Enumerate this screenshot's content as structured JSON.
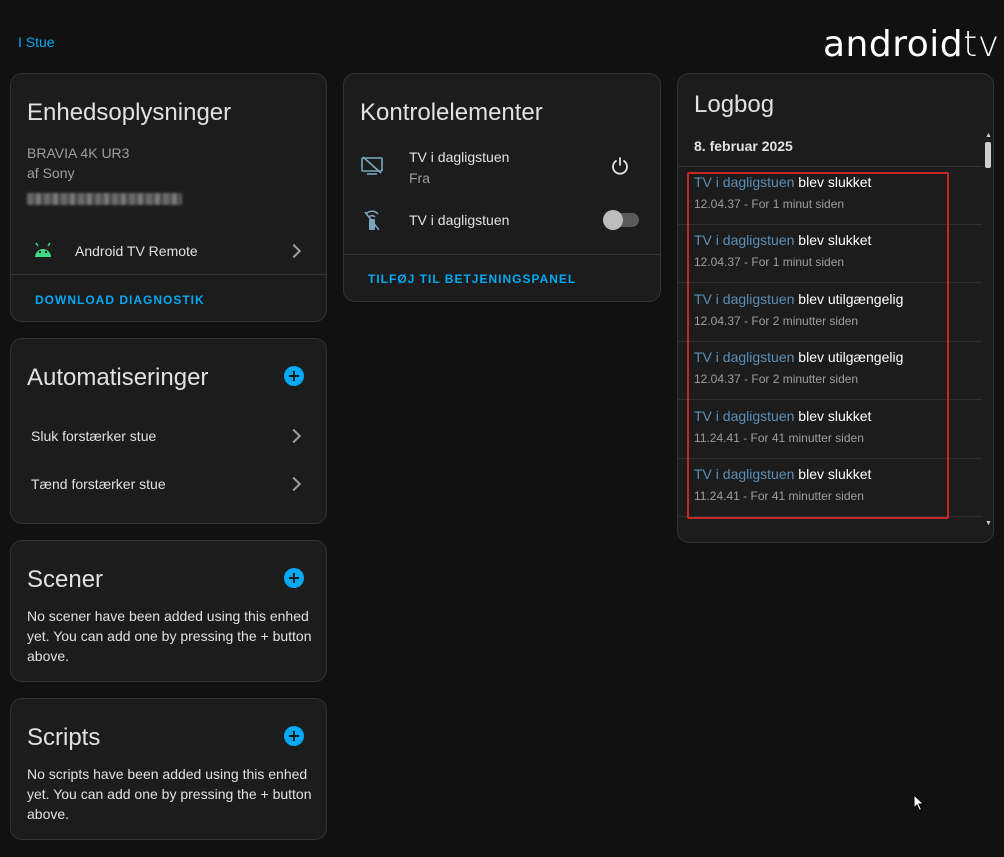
{
  "header": {
    "area_link": "I Stue",
    "logo_part1": "android",
    "logo_part2": "tv"
  },
  "device_info": {
    "title": "Enhedsoplysninger",
    "model": "BRAVIA 4K UR3",
    "manufacturer": "af Sony",
    "integration_name": "Android TV Remote",
    "download_button": "DOWNLOAD DIAGNOSTIK"
  },
  "automations": {
    "title": "Automatiseringer",
    "items": [
      {
        "label": "Sluk forstærker stue"
      },
      {
        "label": "Tænd forstærker stue"
      }
    ]
  },
  "scenes": {
    "title": "Scener",
    "empty_text": "No scener have been added using this enhed yet. You can add one by pressing the + button above."
  },
  "scripts": {
    "title": "Scripts",
    "empty_text": "No scripts have been added using this enhed yet. You can add one by pressing the + button above."
  },
  "controls": {
    "title": "Kontrolelementer",
    "items": [
      {
        "name": "TV i dagligstuen",
        "state": "Fra",
        "icon": "tv-off-icon",
        "control": "power-icon"
      },
      {
        "name": "TV i dagligstuen",
        "icon": "remote-off-icon",
        "control": "toggle",
        "on": false
      }
    ],
    "add_button": "TILFØJ TIL BETJENINGSPANEL"
  },
  "logbook": {
    "title": "Logbog",
    "date": "8. februar 2025",
    "entries": [
      {
        "entity": "TV i dagligstuen",
        "message": "blev slukket",
        "time": "12.04.37 - For 1 minut siden"
      },
      {
        "entity": "TV i dagligstuen",
        "message": "blev slukket",
        "time": "12.04.37 - For 1 minut siden"
      },
      {
        "entity": "TV i dagligstuen",
        "message": "blev utilgængelig",
        "time": "12.04.37 - For 2 minutter siden"
      },
      {
        "entity": "TV i dagligstuen",
        "message": "blev utilgængelig",
        "time": "12.04.37 - For 2 minutter siden"
      },
      {
        "entity": "TV i dagligstuen",
        "message": "blev slukket",
        "time": "11.24.41 - For 41 minutter siden"
      },
      {
        "entity": "TV i dagligstuen",
        "message": "blev slukket",
        "time": "11.24.41 - For 41 minutter siden"
      }
    ]
  },
  "colors": {
    "background": "#111111",
    "card": "#1c1c1c",
    "accent": "#03a9f4",
    "android_green": "#3ddc84",
    "highlight_red": "#c62828"
  }
}
